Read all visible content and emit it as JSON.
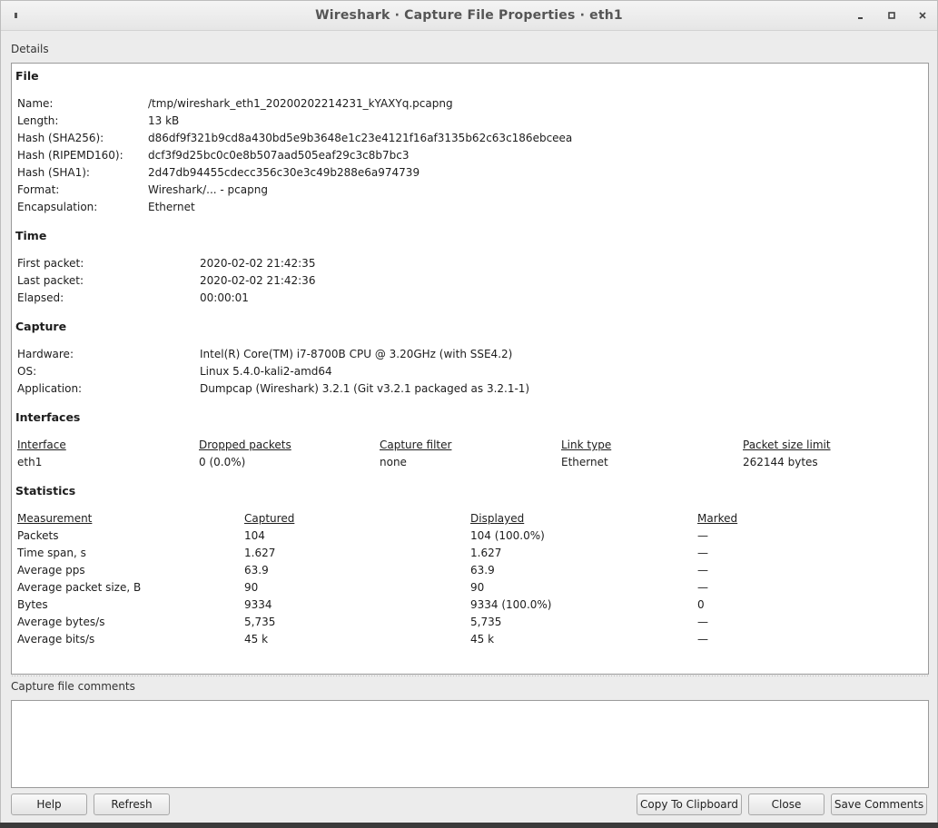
{
  "window": {
    "title": "Wireshark · Capture File Properties · eth1",
    "menu_icon": "window-menu-icon",
    "minimize_icon": "minimize-icon",
    "maximize_icon": "maximize-icon",
    "close_icon": "close-icon"
  },
  "details_label": "Details",
  "file": {
    "heading": "File",
    "rows": [
      {
        "label": "Name:",
        "value": "/tmp/wireshark_eth1_20200202214231_kYAXYq.pcapng"
      },
      {
        "label": "Length:",
        "value": "13 kB"
      },
      {
        "label": "Hash (SHA256):",
        "value": "d86df9f321b9cd8a430bd5e9b3648e1c23e4121f16af3135b62c63c186ebceea"
      },
      {
        "label": "Hash (RIPEMD160):",
        "value": "dcf3f9d25bc0c0e8b507aad505eaf29c3c8b7bc3"
      },
      {
        "label": "Hash (SHA1):",
        "value": "2d47db94455cdecc356c30e3c49b288e6a974739"
      },
      {
        "label": "Format:",
        "value": "Wireshark/... - pcapng"
      },
      {
        "label": "Encapsulation:",
        "value": "Ethernet"
      }
    ]
  },
  "time": {
    "heading": "Time",
    "rows": [
      {
        "label": "First packet:",
        "value": "2020-02-02 21:42:35"
      },
      {
        "label": "Last packet:",
        "value": "2020-02-02 21:42:36"
      },
      {
        "label": "Elapsed:",
        "value": "00:00:01"
      }
    ]
  },
  "capture": {
    "heading": "Capture",
    "rows": [
      {
        "label": "Hardware:",
        "value": "Intel(R) Core(TM) i7-8700B CPU @ 3.20GHz (with SSE4.2)"
      },
      {
        "label": "OS:",
        "value": "Linux 5.4.0-kali2-amd64"
      },
      {
        "label": "Application:",
        "value": "Dumpcap (Wireshark) 3.2.1 (Git v3.2.1 packaged as 3.2.1-1)"
      }
    ]
  },
  "interfaces": {
    "heading": "Interfaces",
    "columns": [
      "Interface",
      "Dropped packets",
      "Capture filter",
      "Link type",
      "Packet size limit"
    ],
    "rows": [
      [
        "eth1",
        "0 (0.0%)",
        "none",
        "Ethernet",
        "262144 bytes"
      ]
    ]
  },
  "statistics": {
    "heading": "Statistics",
    "columns": [
      "Measurement",
      "Captured",
      "Displayed",
      "Marked"
    ],
    "rows": [
      [
        "Packets",
        "104",
        "104 (100.0%)",
        "—"
      ],
      [
        "Time span, s",
        "1.627",
        "1.627",
        "—"
      ],
      [
        "Average pps",
        "63.9",
        "63.9",
        "—"
      ],
      [
        "Average packet size, B",
        "90",
        "90",
        "—"
      ],
      [
        "Bytes",
        "9334",
        "9334 (100.0%)",
        "0"
      ],
      [
        "Average bytes/s",
        "5,735",
        "5,735",
        "—"
      ],
      [
        "Average bits/s",
        "45 k",
        "45 k",
        "—"
      ]
    ]
  },
  "comments_label": "Capture file comments",
  "buttons": {
    "help": "Help",
    "refresh": "Refresh",
    "copy": "Copy To Clipboard",
    "close": "Close",
    "save_comments": "Save Comments"
  }
}
